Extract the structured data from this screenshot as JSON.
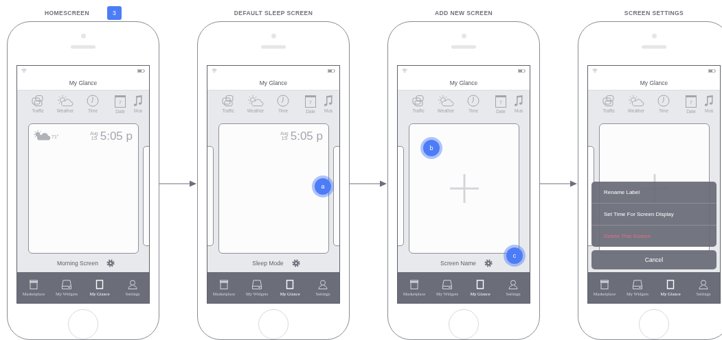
{
  "screens": [
    {
      "heading": "HOMESCREEN",
      "badge": "3",
      "app_title": "My Glance",
      "widgets": [
        {
          "kind": "traffic",
          "label": "Traffic"
        },
        {
          "kind": "weather",
          "label": "Weather"
        },
        {
          "kind": "time",
          "label": "Time"
        },
        {
          "kind": "date",
          "label": "Date",
          "icon_text": "7"
        },
        {
          "kind": "music",
          "label": "Mus"
        }
      ],
      "card": {
        "kind": "clock",
        "weather_temp": "71°",
        "month": "Aug",
        "day": "15",
        "time": "5:05 p"
      },
      "peek_left": false,
      "peek_right": true,
      "screen_label": "Morning Screen",
      "tabs": [
        {
          "kind": "marketplace",
          "label": "Marketplace",
          "selected": false
        },
        {
          "kind": "widgets",
          "label": "My Widgets",
          "selected": false
        },
        {
          "kind": "glance",
          "label": "My Glance",
          "selected": true
        },
        {
          "kind": "settings",
          "label": "Settings",
          "selected": false
        }
      ]
    },
    {
      "heading": "DEFAULT SLEEP SCREEN",
      "app_title": "My Glance",
      "widgets": [
        {
          "kind": "traffic",
          "label": "Traffic"
        },
        {
          "kind": "weather",
          "label": "Weather"
        },
        {
          "kind": "time",
          "label": "Time"
        },
        {
          "kind": "date",
          "label": "Date",
          "icon_text": "7"
        },
        {
          "kind": "music",
          "label": "Mus"
        }
      ],
      "card": {
        "kind": "clock",
        "month": "Aug",
        "day": "15",
        "time": "5:05 p"
      },
      "peek_left": true,
      "peek_right": true,
      "screen_label": "Sleep Mode",
      "markers": [
        {
          "label": "a",
          "kind": "card-right"
        }
      ],
      "tabs": [
        {
          "kind": "marketplace",
          "label": "Marketplace",
          "selected": false
        },
        {
          "kind": "widgets",
          "label": "My Widgets",
          "selected": false
        },
        {
          "kind": "glance",
          "label": "My Glance",
          "selected": true
        },
        {
          "kind": "settings",
          "label": "Settings",
          "selected": false
        }
      ]
    },
    {
      "heading": "ADD NEW SCREEN",
      "app_title": "My Glance",
      "widgets": [
        {
          "kind": "traffic",
          "label": "Traffic"
        },
        {
          "kind": "weather",
          "label": "Weather"
        },
        {
          "kind": "time",
          "label": "Time"
        },
        {
          "kind": "date",
          "label": "Date",
          "icon_text": "7"
        },
        {
          "kind": "music",
          "label": "Mus"
        }
      ],
      "card": {
        "kind": "add"
      },
      "peek_left": true,
      "peek_right": false,
      "screen_label": "Screen Name",
      "markers": [
        {
          "label": "b",
          "kind": "card-top-left"
        },
        {
          "label": "c",
          "kind": "card-bottom-right"
        }
      ],
      "tabs": [
        {
          "kind": "marketplace",
          "label": "Marketplace",
          "selected": false
        },
        {
          "kind": "widgets",
          "label": "My Widgets",
          "selected": false
        },
        {
          "kind": "glance",
          "label": "My Glance",
          "selected": true
        },
        {
          "kind": "settings",
          "label": "Settings",
          "selected": false
        }
      ]
    },
    {
      "heading": "SCREEN SETTINGS",
      "app_title": "My Glance",
      "widgets": [
        {
          "kind": "traffic",
          "label": "Traffic"
        },
        {
          "kind": "weather",
          "label": "Weather"
        },
        {
          "kind": "time",
          "label": "Time"
        },
        {
          "kind": "date",
          "label": "Date",
          "icon_text": "7"
        },
        {
          "kind": "music",
          "label": "Mus"
        }
      ],
      "card": {
        "kind": "add"
      },
      "peek_left": true,
      "peek_right": false,
      "action_sheet": {
        "items": [
          {
            "kind": "normal",
            "label": "Rename Label"
          },
          {
            "kind": "normal",
            "label": "Set Time For Screen Display"
          },
          {
            "kind": "destructive",
            "label": "Delete This Screen"
          }
        ],
        "cancel": "Cancel"
      },
      "tabs": [
        {
          "kind": "marketplace",
          "label": "Marketplace",
          "selected": false
        },
        {
          "kind": "widgets",
          "label": "My Widgets",
          "selected": false
        },
        {
          "kind": "glance",
          "label": "My Glance",
          "selected": true
        },
        {
          "kind": "settings",
          "label": "Settings",
          "selected": false
        }
      ]
    }
  ]
}
